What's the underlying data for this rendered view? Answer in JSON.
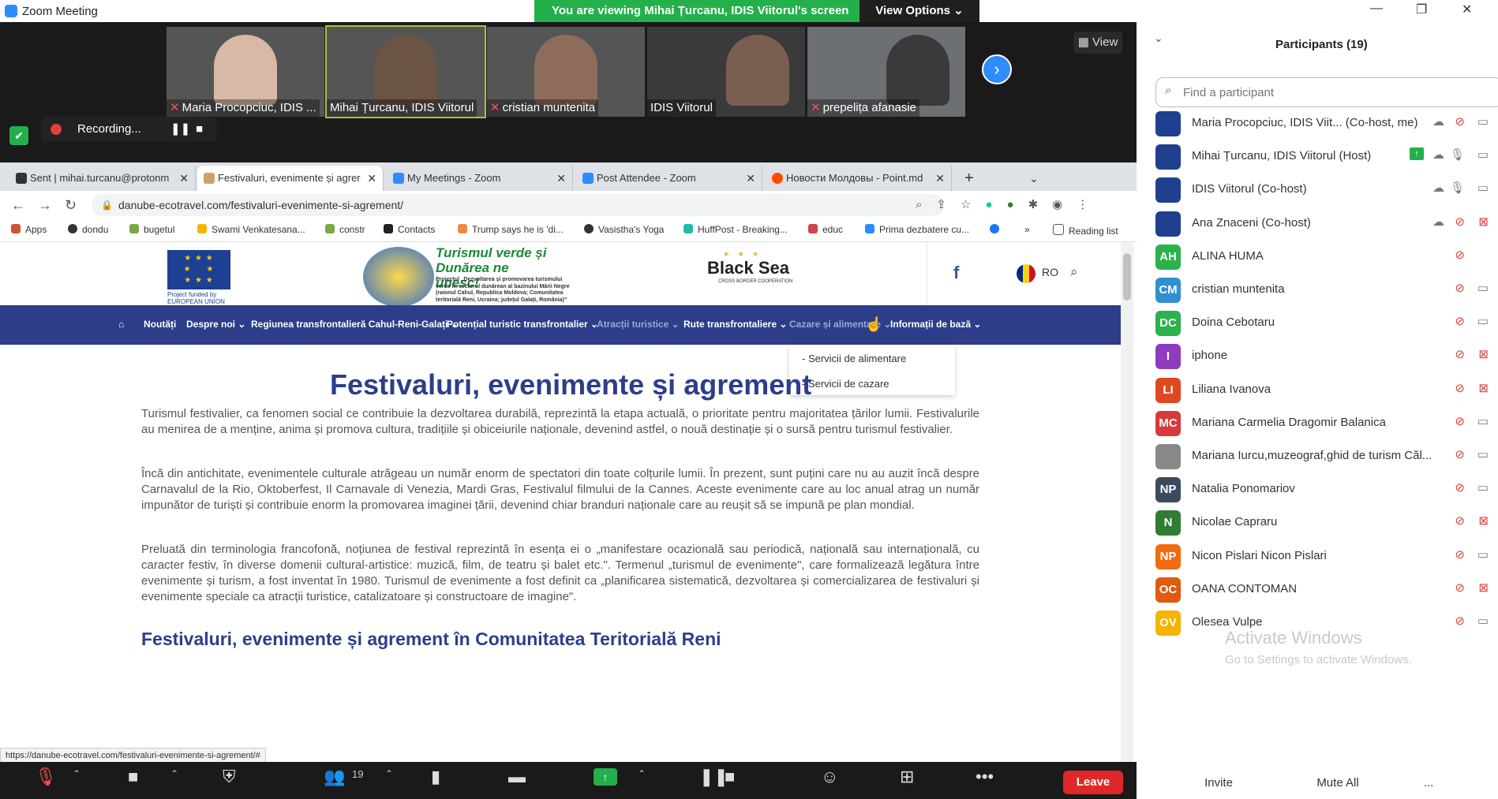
{
  "window": {
    "title": "Zoom Meeting"
  },
  "banner": {
    "viewing": "You are viewing Mihai Țurcanu, IDIS Viitorul's screen",
    "view_options": "View Options ⌄"
  },
  "gallery": {
    "view_label": "View",
    "thumbs": [
      {
        "name": "Maria Procopciuc, IDIS ..."
      },
      {
        "name": "Mihai Țurcanu, IDIS Viitorul"
      },
      {
        "name": "cristian muntenita"
      },
      {
        "name": "IDIS Viitorul"
      },
      {
        "name": "prepelița afanasie"
      }
    ]
  },
  "recording": {
    "label": "Recording..."
  },
  "browser": {
    "tabs": [
      {
        "label": "Sent | mihai.turcanu@protonm"
      },
      {
        "label": "Festivaluri, evenimente și agrer"
      },
      {
        "label": "My Meetings - Zoom"
      },
      {
        "label": "Post Attendee - Zoom"
      },
      {
        "label": "Новости Молдовы - Point.md"
      }
    ],
    "url": "danube-ecotravel.com/festivaluri-evenimente-si-agrement/",
    "bookmarks": [
      {
        "label": "Apps"
      },
      {
        "label": "dondu"
      },
      {
        "label": "bugetul"
      },
      {
        "label": "Swami Venkatesana..."
      },
      {
        "label": "constr"
      },
      {
        "label": "Contacts"
      },
      {
        "label": "Trump says he is 'di..."
      },
      {
        "label": "Vasistha's Yoga"
      },
      {
        "label": "HuffPost - Breaking..."
      },
      {
        "label": "educ"
      },
      {
        "label": "Prima dezbatere cu..."
      },
      {
        "label": "Reading list"
      }
    ],
    "status_url": "https://danube-ecotravel.com/festivaluri-evenimente-si-agrement/#"
  },
  "site": {
    "eu_text": "Project funded by EUROPEAN UNION",
    "logo_title": "Turismul verde și Dunărea ne unesc!",
    "logo_desc": "Proiectul „Dezvoltarea și promovarea turismului verde în sectorul dunărean al bazinului Mării Negre (raionul Cahul, Republica Moldova; Comunitatea teritorială Reni, Ucraina; județul Galați, România)\"",
    "bs_logo": "Black Sea",
    "bs_sub": "CROSS BORDER COOPERATION",
    "lang": "RO",
    "menu": [
      {
        "label": "Noutăți"
      },
      {
        "label": "Despre noi ⌄"
      },
      {
        "label": "Regiunea transfrontalieră Cahul-Reni-Galați ⌄"
      },
      {
        "label": "Potențial turistic transfrontalier ⌄"
      },
      {
        "label": "Atracții turistice ⌄"
      },
      {
        "label": "Rute transfrontaliere ⌄"
      },
      {
        "label": "Cazare și alimentare ⌄"
      },
      {
        "label": "Informații de bază ⌄"
      }
    ],
    "dropdown": [
      "- Servicii de alimentare",
      "- Servicii de cazare"
    ],
    "title": "Festivaluri, evenimente și agrement",
    "paragraphs": [
      "Turismul festivalier, ca fenomen social ce contribuie la dezvoltarea durabilă, reprezintă la etapa actuală, o prioritate pentru majoritatea țărilor lumii. Festivalurile au menirea de a menține, anima și promova cultura, tradițiile și obiceiurile naționale, devenind astfel, o nouă destinație și o sursă pentru turismul festivalier.",
      "Încă din antichitate, evenimentele culturale atrăgeau un număr enorm de spectatori din toate colțurile lumii. În prezent, sunt puțini care nu au auzit încă despre Carnavalul de la Rio, Oktoberfest, Il Carnavale di Venezia, Mardi Gras, Festivalul filmului de la Cannes. Aceste evenimente care au loc anual atrag un număr impunător de turiști și contribuie enorm la promovarea imaginei țării, devenind chiar branduri naționale care au reușit să se impună pe plan mondial.",
      "Preluată din terminologia francofonă, noțiunea de festival reprezintă în esența ei o „manifestare ocazională sau periodică, națională sau internațională, cu caracter festiv, în diverse domenii cultural-artistice: muzică, film, de teatru și balet etc.\". Termenul „turismul de evenimente\", care formalizează legătura între evenimente și turism, a fost inventat în 1980. Turismul de evenimente a fost definit ca „planificarea sistematică, dezvoltarea și comercializarea de festivaluri și evenimente speciale ca atracții turistice, catalizatoare și constructoare de imagine\"."
    ],
    "subheading": "Festivaluri, evenimente și agrement în Comunitatea Teritorială Reni"
  },
  "controls": {
    "participants_count": "19",
    "leave": "Leave"
  },
  "panel": {
    "title": "Participants (19)",
    "search_placeholder": "Find a participant",
    "participants": [
      {
        "initials": "",
        "name": "Maria Procopciuc, IDIS Viit... (Co-host, me)",
        "color": "#1f3f8f"
      },
      {
        "initials": "",
        "name": "Mihai Țurcanu, IDIS Viitorul (Host)",
        "color": "#1f3f8f"
      },
      {
        "initials": "",
        "name": "IDIS Viitorul (Co-host)",
        "color": "#1f3f8f"
      },
      {
        "initials": "",
        "name": "Ana Znaceni (Co-host)",
        "color": "#1f3f8f"
      },
      {
        "initials": "AH",
        "name": "ALINA HUMA",
        "color": "#2bb24c"
      },
      {
        "initials": "CM",
        "name": "cristian muntenita",
        "color": "#2f8fd0"
      },
      {
        "initials": "DC",
        "name": "Doina Cebotaru",
        "color": "#2bb24c"
      },
      {
        "initials": "I",
        "name": "iphone",
        "color": "#8e3bbf"
      },
      {
        "initials": "LI",
        "name": "Liliana Ivanova",
        "color": "#e0481f"
      },
      {
        "initials": "MC",
        "name": "Mariana Carmelia Dragomir Balanica",
        "color": "#d63a3a"
      },
      {
        "initials": "",
        "name": "Mariana Iurcu,muzeograf,ghid de turism Căl...",
        "color": "#888888"
      },
      {
        "initials": "NP",
        "name": "Natalia Ponomariov",
        "color": "#3b4a5e"
      },
      {
        "initials": "N",
        "name": "Nicolae Capraru",
        "color": "#2e7d32"
      },
      {
        "initials": "NP",
        "name": "Nicon Pislari Nicon Pislari",
        "color": "#f06a10"
      },
      {
        "initials": "OC",
        "name": "OANA CONTOMAN",
        "color": "#e05a10"
      },
      {
        "initials": "OV",
        "name": "Olesea Vulpe",
        "color": "#f5b400"
      }
    ],
    "invite": "Invite",
    "mute_all": "Mute All",
    "more": "...",
    "watermark_title": "Activate Windows",
    "watermark_sub": "Go to Settings to activate Windows."
  }
}
